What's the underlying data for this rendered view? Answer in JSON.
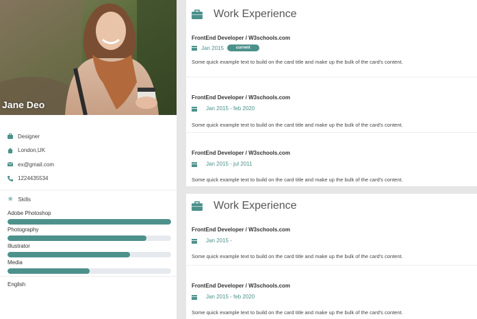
{
  "profile": {
    "name": "Jane Deo",
    "title": "Designer",
    "location": "London,UK",
    "email": "ex@gmail.com",
    "phone": "1224435534"
  },
  "skills": {
    "heading": "Skills",
    "items": [
      {
        "label": "Adobe Photoshop",
        "level": 1.0
      },
      {
        "label": "Photography",
        "level": 0.85
      },
      {
        "label": "Illustrator",
        "level": 0.75
      },
      {
        "label": "Media",
        "level": 0.5
      }
    ]
  },
  "languages": {
    "items": [
      "English"
    ]
  },
  "cards": [
    {
      "title": "Work Experience",
      "entries": [
        {
          "role": "FrontEnd Developer / W3schools.com",
          "date": "Jan 2015",
          "badge": "current",
          "text": "Some quick example text to build on the card title and make up the bulk of the card's content."
        },
        {
          "role": "FrontEnd Developer / W3schools.com",
          "date": "Jan 2015 - feb 2020",
          "badge": "",
          "text": "Some quick example text to build on the card title and make up the bulk of the card's content."
        },
        {
          "role": "FrontEnd Developer / W3schools.com",
          "date": "Jan 2015 - jul 2011",
          "badge": "",
          "text": "Some quick example text to build on the card title and make up the bulk of the card's content."
        }
      ]
    },
    {
      "title": "Work Experience",
      "entries": [
        {
          "role": "FrontEnd Developer / W3schools.com",
          "date": "Jan 2015 -",
          "badge": "",
          "text": "Some quick example text to build on the card title and make up the bulk of the card's content."
        },
        {
          "role": "FrontEnd Developer / W3schools.com",
          "date": "Jan 2015 - feb 2020",
          "badge": "",
          "text": "Some quick example text to build on the card title and make up the bulk of the card's content."
        }
      ]
    }
  ],
  "colors": {
    "accent": "#4d918b",
    "background": "#e6e6e6"
  },
  "icons": {
    "title": "briefcase-icon",
    "location": "home-icon",
    "email": "envelope-icon",
    "phone": "phone-icon",
    "skills": "asterisk-icon",
    "date": "calendar-icon"
  }
}
